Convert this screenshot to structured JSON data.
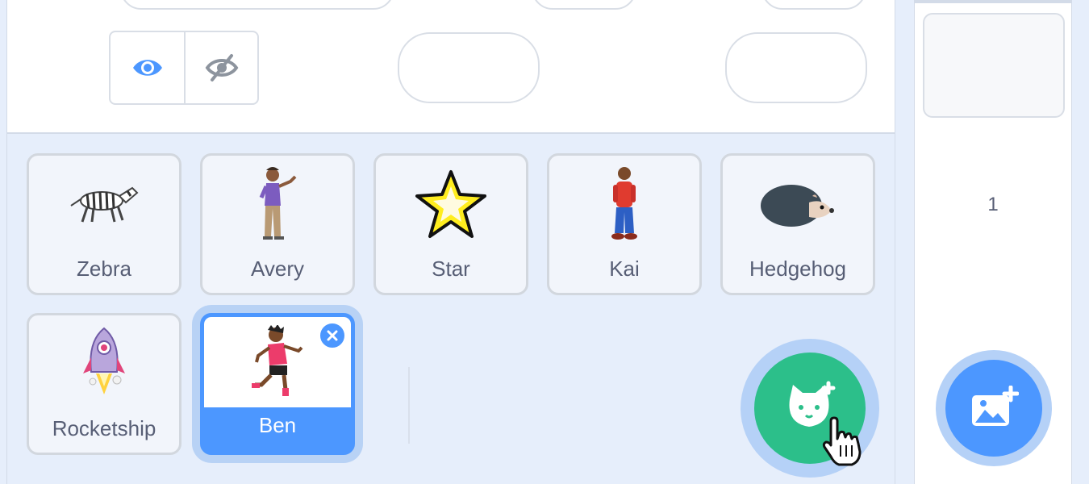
{
  "sprite_info": {
    "visibility": {
      "show_icon": "eye-icon",
      "hide_icon": "eye-slash-icon",
      "selected": "show"
    }
  },
  "sprites": [
    {
      "name": "Zebra",
      "icon": "zebra-costume",
      "selected": false
    },
    {
      "name": "Avery",
      "icon": "avery-costume",
      "selected": false
    },
    {
      "name": "Star",
      "icon": "star-costume",
      "selected": false
    },
    {
      "name": "Kai",
      "icon": "kai-costume",
      "selected": false
    },
    {
      "name": "Hedgehog",
      "icon": "hedgehog-costume",
      "selected": false
    },
    {
      "name": "Rocketship",
      "icon": "rocketship-costume",
      "selected": false
    },
    {
      "name": "Ben",
      "icon": "ben-costume",
      "selected": true
    }
  ],
  "stage": {
    "backdrop_count": "1"
  },
  "colors": {
    "accent": "#4c97ff",
    "add_sprite": "#2cbf8a",
    "panel_bg": "#e6eefb"
  }
}
